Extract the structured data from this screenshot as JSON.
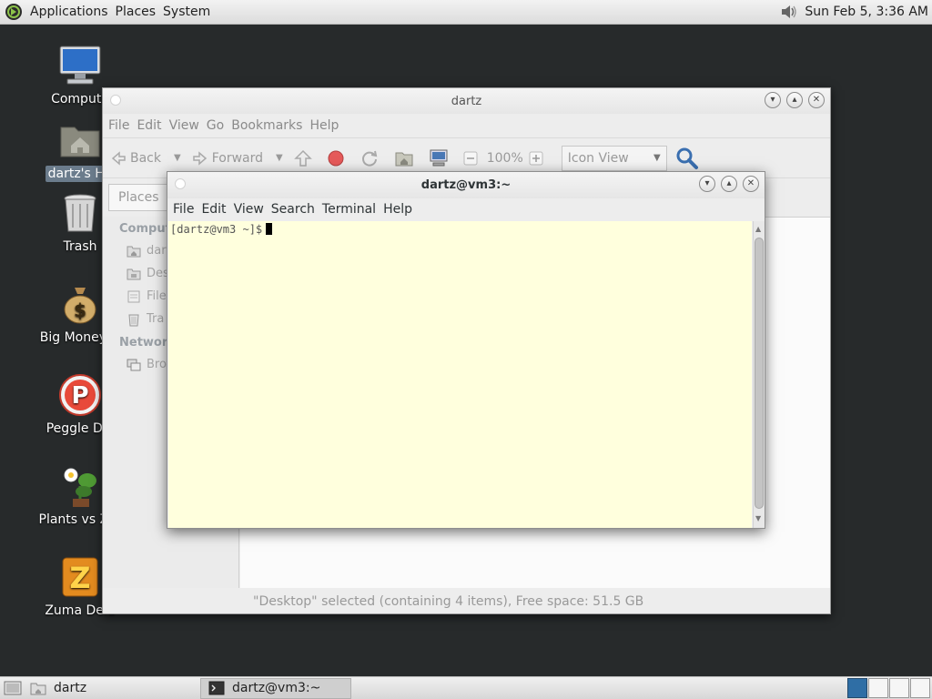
{
  "top_panel": {
    "menus": [
      "Applications",
      "Places",
      "System"
    ],
    "clock": "Sun Feb  5,  3:36 AM"
  },
  "desktop_icons": [
    {
      "label": "Compute",
      "icon": "computer-icon"
    },
    {
      "label": "dartz's Ho",
      "icon": "home-folder-icon"
    },
    {
      "label": "Trash",
      "icon": "trash-icon"
    },
    {
      "label": "Big Money D",
      "icon": "money-bag-icon"
    },
    {
      "label": "Peggle Del",
      "icon": "peggle-icon"
    },
    {
      "label": "Plants vs Zor",
      "icon": "plants-icon"
    },
    {
      "label": "Zuma Delu",
      "icon": "zuma-icon"
    }
  ],
  "file_manager": {
    "title": "dartz",
    "menu": [
      "File",
      "Edit",
      "View",
      "Go",
      "Bookmarks",
      "Help"
    ],
    "toolbar": {
      "back": "Back",
      "forward": "Forward",
      "zoom": "100%",
      "view_mode": "Icon View"
    },
    "location_button": "Places",
    "sidebar": {
      "computer_heading": "Compute",
      "items": [
        {
          "label": "dar",
          "icon": "home-icon"
        },
        {
          "label": "Des",
          "icon": "desktop-icon"
        },
        {
          "label": "File",
          "icon": "filesystem-icon"
        },
        {
          "label": "Tra",
          "icon": "trash-icon"
        }
      ],
      "network_heading": "Network",
      "network_items": [
        {
          "label": "Bro",
          "icon": "network-icon"
        }
      ]
    },
    "status": "\"Desktop\" selected (containing 4 items), Free space: 51.5 GB"
  },
  "terminal": {
    "title": "dartz@vm3:~",
    "menu": [
      "File",
      "Edit",
      "View",
      "Search",
      "Terminal",
      "Help"
    ],
    "prompt": "[dartz@vm3 ~]$"
  },
  "taskbar": {
    "tasks": [
      {
        "label": "dartz",
        "icon": "folder-icon"
      },
      {
        "label": "dartz@vm3:~",
        "icon": "terminal-icon"
      }
    ]
  }
}
